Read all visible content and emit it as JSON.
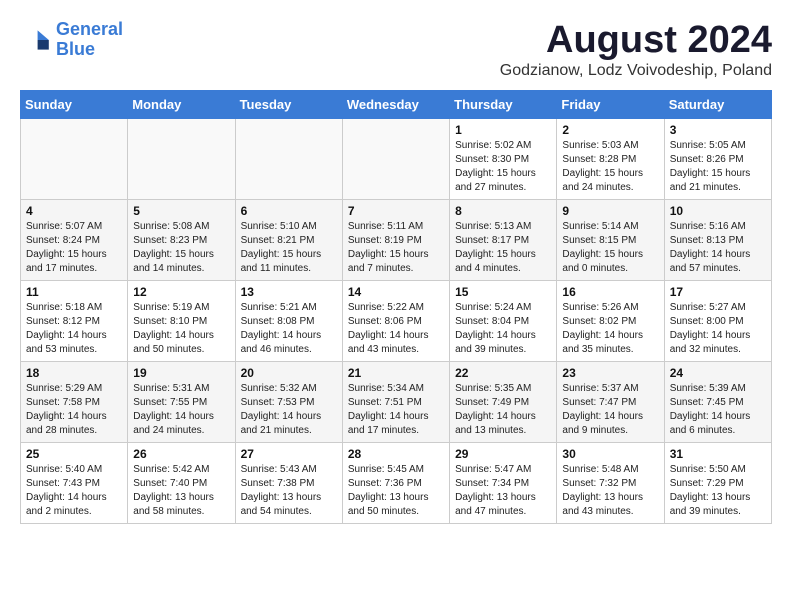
{
  "header": {
    "logo_line1": "General",
    "logo_line2": "Blue",
    "main_title": "August 2024",
    "subtitle": "Godzianow, Lodz Voivodeship, Poland"
  },
  "days_of_week": [
    "Sunday",
    "Monday",
    "Tuesday",
    "Wednesday",
    "Thursday",
    "Friday",
    "Saturday"
  ],
  "weeks": [
    [
      {
        "day": "",
        "info": ""
      },
      {
        "day": "",
        "info": ""
      },
      {
        "day": "",
        "info": ""
      },
      {
        "day": "",
        "info": ""
      },
      {
        "day": "1",
        "info": "Sunrise: 5:02 AM\nSunset: 8:30 PM\nDaylight: 15 hours\nand 27 minutes."
      },
      {
        "day": "2",
        "info": "Sunrise: 5:03 AM\nSunset: 8:28 PM\nDaylight: 15 hours\nand 24 minutes."
      },
      {
        "day": "3",
        "info": "Sunrise: 5:05 AM\nSunset: 8:26 PM\nDaylight: 15 hours\nand 21 minutes."
      }
    ],
    [
      {
        "day": "4",
        "info": "Sunrise: 5:07 AM\nSunset: 8:24 PM\nDaylight: 15 hours\nand 17 minutes."
      },
      {
        "day": "5",
        "info": "Sunrise: 5:08 AM\nSunset: 8:23 PM\nDaylight: 15 hours\nand 14 minutes."
      },
      {
        "day": "6",
        "info": "Sunrise: 5:10 AM\nSunset: 8:21 PM\nDaylight: 15 hours\nand 11 minutes."
      },
      {
        "day": "7",
        "info": "Sunrise: 5:11 AM\nSunset: 8:19 PM\nDaylight: 15 hours\nand 7 minutes."
      },
      {
        "day": "8",
        "info": "Sunrise: 5:13 AM\nSunset: 8:17 PM\nDaylight: 15 hours\nand 4 minutes."
      },
      {
        "day": "9",
        "info": "Sunrise: 5:14 AM\nSunset: 8:15 PM\nDaylight: 15 hours\nand 0 minutes."
      },
      {
        "day": "10",
        "info": "Sunrise: 5:16 AM\nSunset: 8:13 PM\nDaylight: 14 hours\nand 57 minutes."
      }
    ],
    [
      {
        "day": "11",
        "info": "Sunrise: 5:18 AM\nSunset: 8:12 PM\nDaylight: 14 hours\nand 53 minutes."
      },
      {
        "day": "12",
        "info": "Sunrise: 5:19 AM\nSunset: 8:10 PM\nDaylight: 14 hours\nand 50 minutes."
      },
      {
        "day": "13",
        "info": "Sunrise: 5:21 AM\nSunset: 8:08 PM\nDaylight: 14 hours\nand 46 minutes."
      },
      {
        "day": "14",
        "info": "Sunrise: 5:22 AM\nSunset: 8:06 PM\nDaylight: 14 hours\nand 43 minutes."
      },
      {
        "day": "15",
        "info": "Sunrise: 5:24 AM\nSunset: 8:04 PM\nDaylight: 14 hours\nand 39 minutes."
      },
      {
        "day": "16",
        "info": "Sunrise: 5:26 AM\nSunset: 8:02 PM\nDaylight: 14 hours\nand 35 minutes."
      },
      {
        "day": "17",
        "info": "Sunrise: 5:27 AM\nSunset: 8:00 PM\nDaylight: 14 hours\nand 32 minutes."
      }
    ],
    [
      {
        "day": "18",
        "info": "Sunrise: 5:29 AM\nSunset: 7:58 PM\nDaylight: 14 hours\nand 28 minutes."
      },
      {
        "day": "19",
        "info": "Sunrise: 5:31 AM\nSunset: 7:55 PM\nDaylight: 14 hours\nand 24 minutes."
      },
      {
        "day": "20",
        "info": "Sunrise: 5:32 AM\nSunset: 7:53 PM\nDaylight: 14 hours\nand 21 minutes."
      },
      {
        "day": "21",
        "info": "Sunrise: 5:34 AM\nSunset: 7:51 PM\nDaylight: 14 hours\nand 17 minutes."
      },
      {
        "day": "22",
        "info": "Sunrise: 5:35 AM\nSunset: 7:49 PM\nDaylight: 14 hours\nand 13 minutes."
      },
      {
        "day": "23",
        "info": "Sunrise: 5:37 AM\nSunset: 7:47 PM\nDaylight: 14 hours\nand 9 minutes."
      },
      {
        "day": "24",
        "info": "Sunrise: 5:39 AM\nSunset: 7:45 PM\nDaylight: 14 hours\nand 6 minutes."
      }
    ],
    [
      {
        "day": "25",
        "info": "Sunrise: 5:40 AM\nSunset: 7:43 PM\nDaylight: 14 hours\nand 2 minutes."
      },
      {
        "day": "26",
        "info": "Sunrise: 5:42 AM\nSunset: 7:40 PM\nDaylight: 13 hours\nand 58 minutes."
      },
      {
        "day": "27",
        "info": "Sunrise: 5:43 AM\nSunset: 7:38 PM\nDaylight: 13 hours\nand 54 minutes."
      },
      {
        "day": "28",
        "info": "Sunrise: 5:45 AM\nSunset: 7:36 PM\nDaylight: 13 hours\nand 50 minutes."
      },
      {
        "day": "29",
        "info": "Sunrise: 5:47 AM\nSunset: 7:34 PM\nDaylight: 13 hours\nand 47 minutes."
      },
      {
        "day": "30",
        "info": "Sunrise: 5:48 AM\nSunset: 7:32 PM\nDaylight: 13 hours\nand 43 minutes."
      },
      {
        "day": "31",
        "info": "Sunrise: 5:50 AM\nSunset: 7:29 PM\nDaylight: 13 hours\nand 39 minutes."
      }
    ]
  ]
}
